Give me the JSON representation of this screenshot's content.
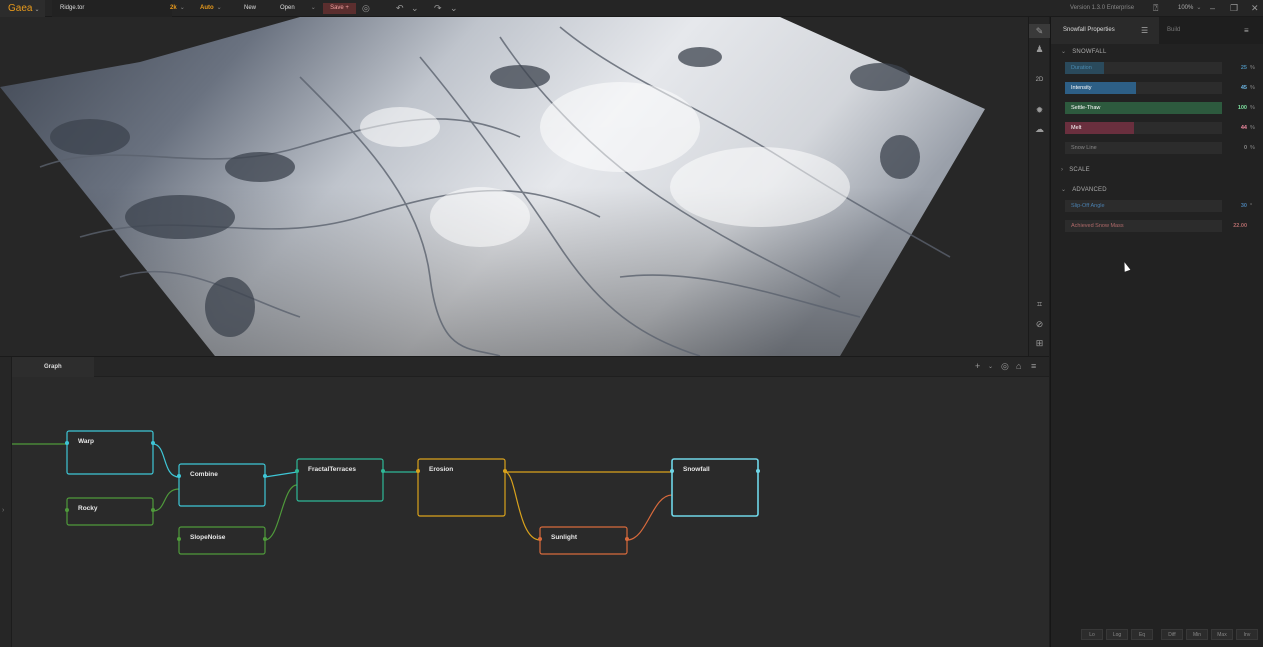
{
  "app": {
    "logo": "Gaea",
    "file_name": "Ridge.tor",
    "resolution": "2k",
    "mode": "Auto",
    "new_label": "New",
    "open_label": "Open",
    "save_label": "Save +",
    "version": "Version 1.3.0 Enterprise",
    "zoom": "100%"
  },
  "viewport": {
    "mode_2d_label": "2D"
  },
  "graph": {
    "tab_label": "Graph",
    "nodes": [
      {
        "label": "Warp",
        "color": "#3ec6d6"
      },
      {
        "label": "Rocky",
        "color": "#4f9a3b"
      },
      {
        "label": "Combine",
        "color": "#3ec6d6"
      },
      {
        "label": "SlopeNoise",
        "color": "#4f9a3b"
      },
      {
        "label": "FractalTerraces",
        "color": "#2fb897"
      },
      {
        "label": "Erosion",
        "color": "#d9a21c"
      },
      {
        "label": "Sunlight",
        "color": "#d86a3c"
      },
      {
        "label": "Snowfall",
        "color": "#6fd6e8"
      }
    ]
  },
  "panel": {
    "properties_tab": "Snowfall Properties",
    "build_tab": "Build",
    "sections": {
      "snowfall": "SNOWFALL",
      "scale": "SCALE",
      "advanced": "ADVANCED"
    },
    "props": [
      {
        "label": "Duration",
        "value": "25",
        "unit": "%",
        "fraction": 0.25,
        "color": "#2a4a5c",
        "text_color": "#4a8ab0",
        "val_color": "#4a8ab0"
      },
      {
        "label": "Intensity",
        "value": "45",
        "unit": "%",
        "fraction": 0.45,
        "color": "#2d5f86",
        "text_color": "#ffffff",
        "val_color": "#6cb7e6"
      },
      {
        "label": "Settle-Thaw",
        "value": "100",
        "unit": "%",
        "fraction": 1.0,
        "color": "#2d5a3e",
        "text_color": "#ffffff",
        "val_color": "#7ee0a0"
      },
      {
        "label": "Melt",
        "value": "44",
        "unit": "%",
        "fraction": 0.44,
        "color": "#6a2f3e",
        "text_color": "#ffffff",
        "val_color": "#f08aa0"
      },
      {
        "label": "Snow Line",
        "value": "0",
        "unit": "%",
        "fraction": 0,
        "color": "#2c2c2c",
        "text_color": "#888888",
        "val_color": "#888888"
      }
    ],
    "advanced_props": [
      {
        "label": "Slip-Off Angle",
        "value": "30",
        "unit": "°",
        "fraction": 0.0,
        "color": "#2c2c2c",
        "text_color": "#4a7fae",
        "val_color": "#4a7fae"
      },
      {
        "label": "Achieved Snow Mass",
        "value": "22.00",
        "unit": "",
        "fraction": 0.0,
        "color": "#2c2c2c",
        "text_color": "#b06a6a",
        "val_color": "#b06a6a"
      }
    ],
    "footer_buttons": [
      "Lo",
      "Log",
      "Eq",
      "Diff",
      "Min",
      "Max",
      "Inv"
    ]
  }
}
